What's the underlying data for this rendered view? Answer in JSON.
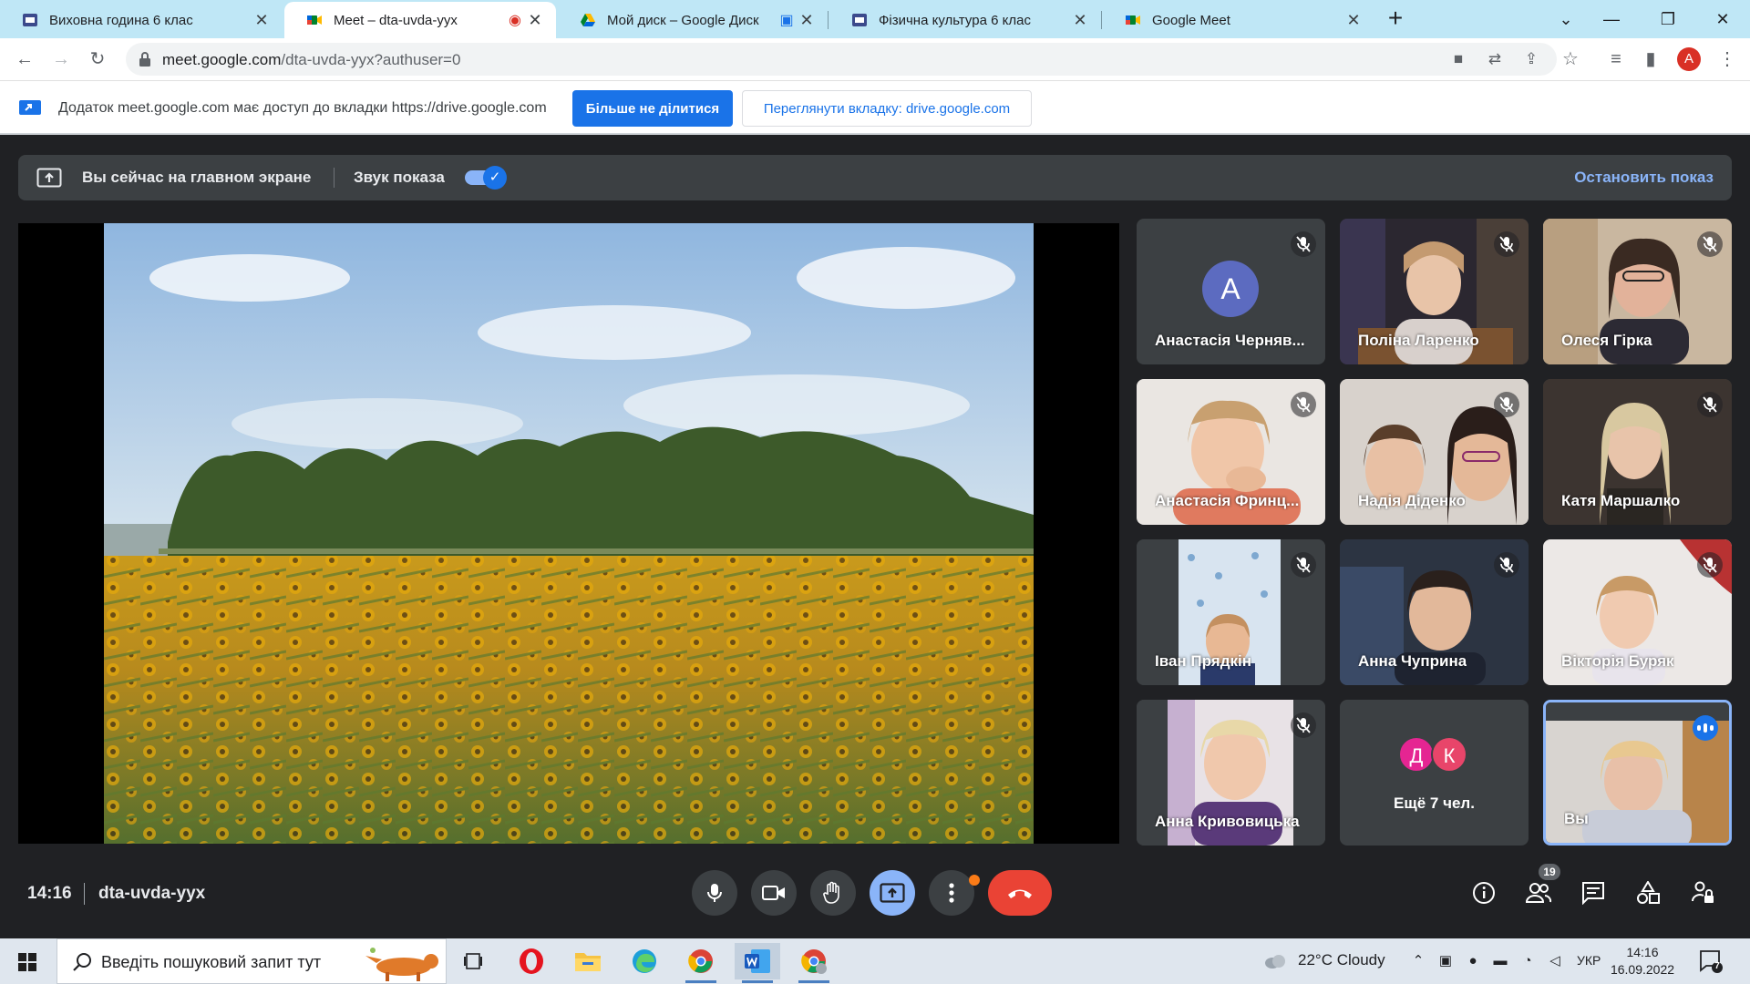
{
  "browser": {
    "tabs": [
      {
        "title": "Виховна година 6 клас",
        "active": false
      },
      {
        "title": "Meet – dta-uvda-yyx",
        "active": true
      },
      {
        "title": "Мой диск – Google Диск",
        "active": false
      },
      {
        "title": "Фізична культура 6 клас",
        "active": false
      },
      {
        "title": "Google Meet",
        "active": false
      }
    ],
    "url_host": "meet.google.com",
    "url_path": "/dta-uvda-yyx?authuser=0",
    "profile_initial": "A"
  },
  "sharebar": {
    "text": "Додаток meet.google.com має доступ до вкладки https://drive.google.com",
    "stop_label": "Більше не ділитися",
    "view_label": "Переглянути вкладку: drive.google.com"
  },
  "presenting": {
    "text": "Вы сейчас на главном экране",
    "sound_label": "Звук показа",
    "sound_on": true,
    "stop_label": "Остановить показ"
  },
  "participants": [
    {
      "name": "Анастасія Черняв...",
      "muted": true,
      "avatar": "А"
    },
    {
      "name": "Поліна Ларенко",
      "muted": true
    },
    {
      "name": "Олеся Гірка",
      "muted": true
    },
    {
      "name": "Анастасія Фринц...",
      "muted": true
    },
    {
      "name": "Надія Діденко",
      "muted": true
    },
    {
      "name": "Катя Маршалко",
      "muted": true
    },
    {
      "name": "Іван Прядкін",
      "muted": true
    },
    {
      "name": "Анна Чуприна",
      "muted": true
    },
    {
      "name": "Вікторія Буряк",
      "muted": true
    },
    {
      "name": "Анна Кривовицька",
      "muted": true
    }
  ],
  "more": {
    "avatars": [
      "Д",
      "К"
    ],
    "label": "Ещё 7 чел."
  },
  "self": {
    "name": "Вы",
    "speaking": true
  },
  "meeting": {
    "time": "14:16",
    "code": "dta-uvda-yyx",
    "participant_count": "19"
  },
  "taskbar": {
    "search_placeholder": "Введіть пошуковий запит тут",
    "weather": "22°C  Cloudy",
    "lang": "УКР",
    "time": "14:16",
    "date": "16.09.2022",
    "notifications": "7"
  },
  "colors": {
    "meet_bg": "#202124",
    "accent": "#8ab4f8",
    "end_call": "#ea4335",
    "share_blue": "#1a73e8"
  }
}
